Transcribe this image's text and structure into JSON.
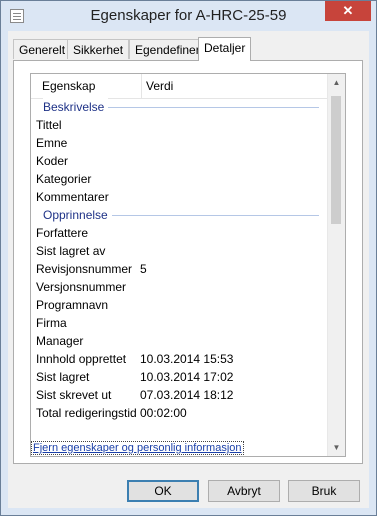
{
  "window": {
    "title": "Egenskaper for A-HRC-25-59",
    "close_glyph": "✕"
  },
  "tabs": [
    {
      "label": "Generelt"
    },
    {
      "label": "Sikkerhet"
    },
    {
      "label": "Egendefinert"
    },
    {
      "label": "Detaljer",
      "selected": true
    }
  ],
  "list": {
    "columns": {
      "property": "Egenskap",
      "value": "Verdi"
    },
    "groups": [
      {
        "title": "Beskrivelse",
        "rows": [
          {
            "key": "Tittel",
            "value": ""
          },
          {
            "key": "Emne",
            "value": ""
          },
          {
            "key": "Koder",
            "value": ""
          },
          {
            "key": "Kategorier",
            "value": ""
          },
          {
            "key": "Kommentarer",
            "value": ""
          }
        ]
      },
      {
        "title": "Opprinnelse",
        "rows": [
          {
            "key": "Forfattere",
            "value": ""
          },
          {
            "key": "Sist lagret av",
            "value": ""
          },
          {
            "key": "Revisjonsnummer",
            "value": "5"
          },
          {
            "key": "Versjonsnummer",
            "value": ""
          },
          {
            "key": "Programnavn",
            "value": ""
          },
          {
            "key": "Firma",
            "value": ""
          },
          {
            "key": "Manager",
            "value": ""
          },
          {
            "key": "Innhold opprettet",
            "value": "10.03.2014 15:53"
          },
          {
            "key": "Sist lagret",
            "value": "10.03.2014 17:02"
          },
          {
            "key": "Sist skrevet ut",
            "value": "07.03.2014 18:12"
          },
          {
            "key": "Total redigeringstid",
            "value": "00:02:00"
          }
        ]
      }
    ],
    "scroll": {
      "up_glyph": "▲",
      "down_glyph": "▼"
    }
  },
  "remove_link": "Fjern egenskaper og personlig informasjon",
  "buttons": {
    "ok": "OK",
    "cancel": "Avbryt",
    "apply": "Bruk"
  }
}
